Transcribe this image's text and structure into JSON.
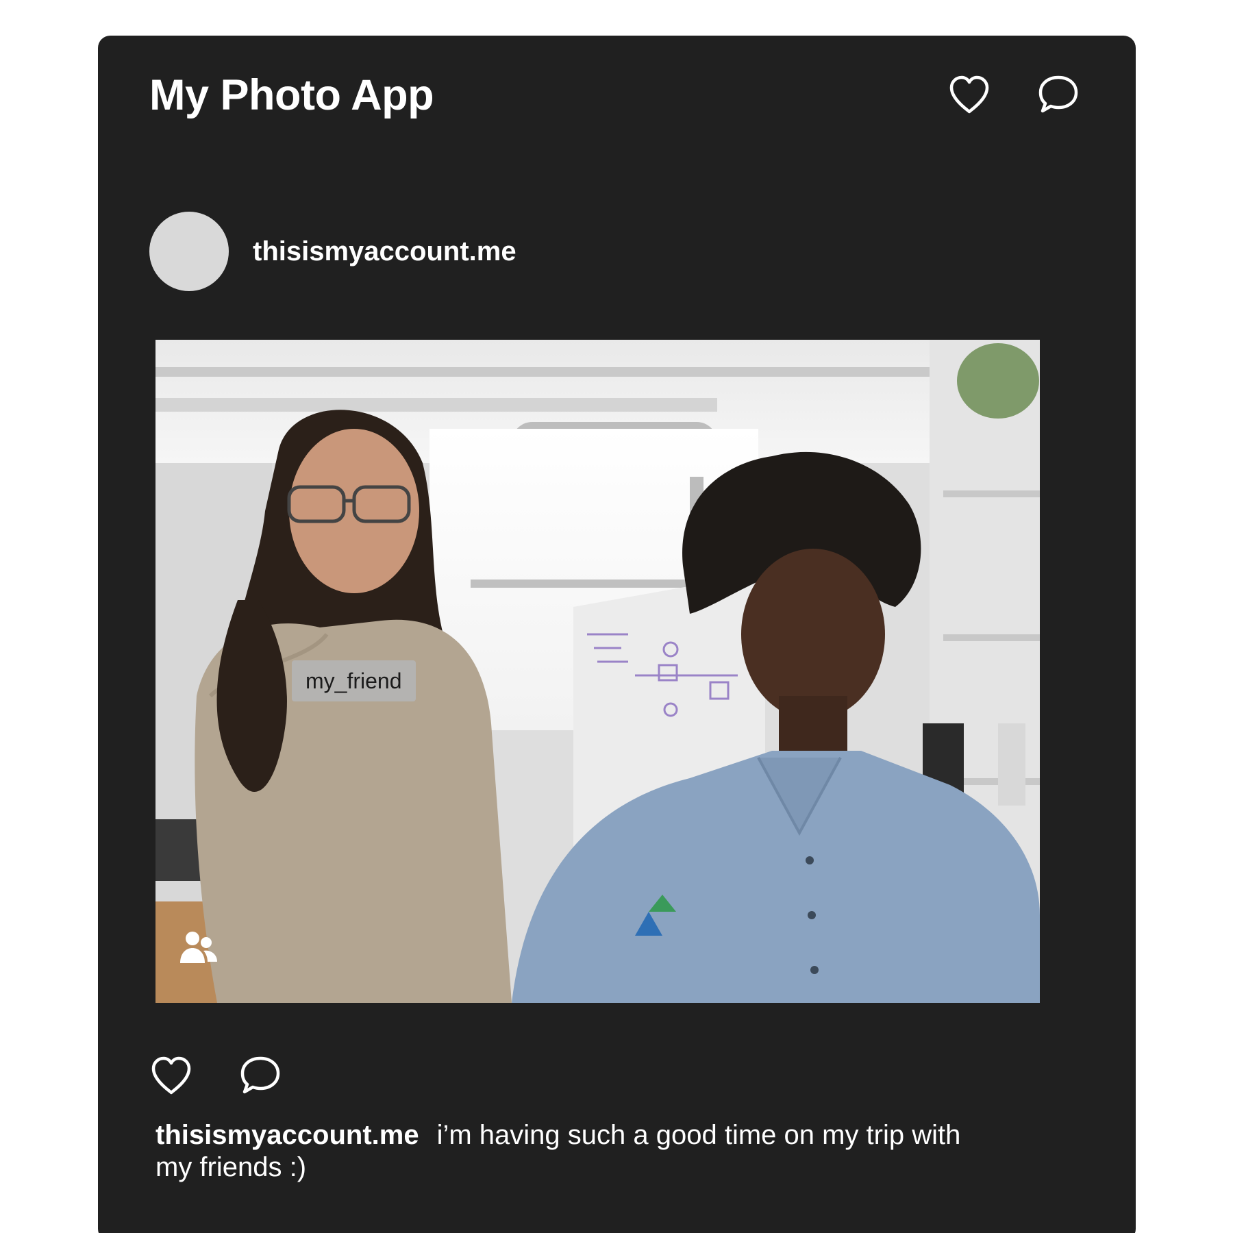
{
  "app": {
    "title": "My Photo App"
  },
  "header": {
    "icons": [
      "heart-icon",
      "chat-bubble-icon"
    ]
  },
  "post": {
    "username": "thisismyaccount.me",
    "photo": {
      "tag": "my_friend",
      "tag_icon": "people-icon"
    },
    "actions": [
      "heart-icon",
      "chat-bubble-icon"
    ],
    "caption": {
      "username": "thisismyaccount.me",
      "text": "i’m having such a good time on my trip with my friends :)"
    }
  },
  "colors": {
    "card_background": "#202020",
    "avatar": "#d9d9d9",
    "text": "#ffffff",
    "tag_background": "#b4b4b4"
  }
}
